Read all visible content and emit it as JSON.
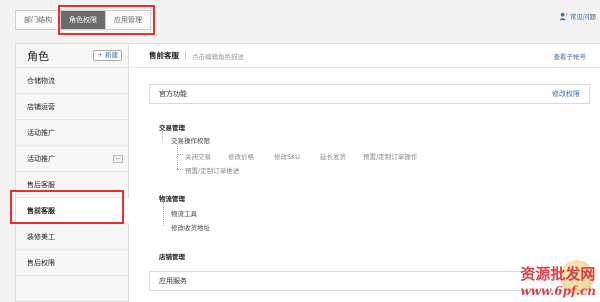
{
  "tabs": [
    {
      "label": "部门结构"
    },
    {
      "label": "角色权限"
    },
    {
      "label": "应用管理"
    }
  ],
  "help": {
    "label": "常见问题"
  },
  "sidebar": {
    "title": "角色",
    "new_button": "+ 新建",
    "items": [
      {
        "label": "仓储物流"
      },
      {
        "label": "店铺运营"
      },
      {
        "label": "活动推广"
      },
      {
        "label": "活动推广"
      },
      {
        "label": "售后客服"
      },
      {
        "label": "售前客服"
      },
      {
        "label": "装修美工"
      },
      {
        "label": "售后权限"
      }
    ]
  },
  "main": {
    "role_name": "售前客服",
    "role_desc_placeholder": "点击编辑角色描述",
    "view_subaccounts": "查看子帐号",
    "official": {
      "title": "官方功能",
      "edit": "修改权限"
    },
    "trade": {
      "group": "交易管理",
      "sub": "交易操作权限",
      "leaves": [
        "关闭交易",
        "修改价格",
        "修改SKU",
        "延长发货",
        "预置/定制订单操作"
      ],
      "leaf2": "预置/定制订单推进"
    },
    "logistics": {
      "group": "物流管理",
      "leaves": [
        "物流工具",
        "修改收货地址"
      ]
    },
    "shop": {
      "group": "店铺管理"
    },
    "apps": {
      "title": "应用服务"
    }
  },
  "watermark": {
    "text": "资源批发网",
    "url": "www.6pf.cn"
  }
}
